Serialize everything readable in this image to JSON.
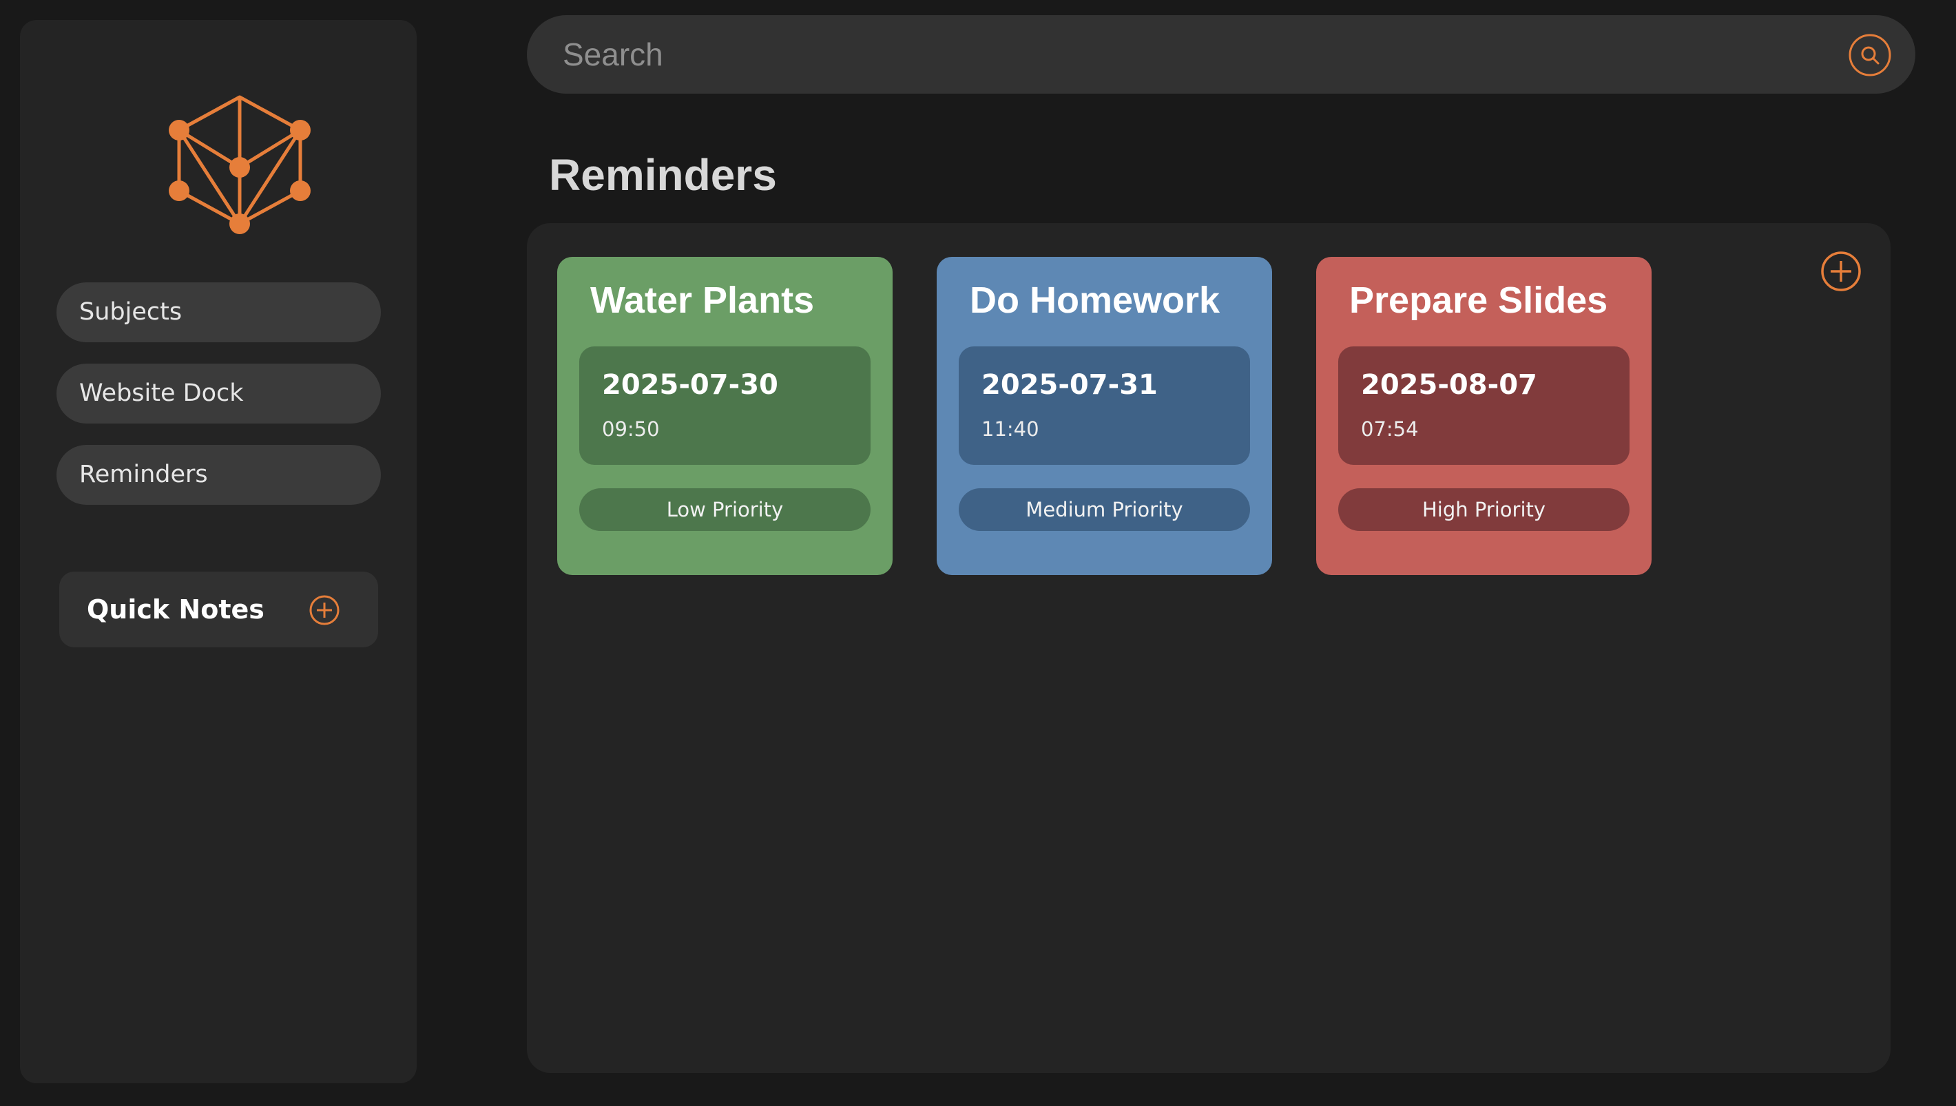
{
  "brand": {
    "accent": "#e67e3a",
    "logo": "hexagon-network-icon"
  },
  "sidebar": {
    "items": [
      {
        "label": "Subjects"
      },
      {
        "label": "Website Dock"
      },
      {
        "label": "Reminders"
      }
    ],
    "quick_notes": {
      "label": "Quick Notes",
      "add_icon": "plus-circle-icon"
    }
  },
  "search": {
    "placeholder": "Search",
    "value": "",
    "icon": "search-icon"
  },
  "main": {
    "title": "Reminders",
    "add_icon": "plus-circle-icon",
    "reminders": [
      {
        "title": "Water Plants",
        "date": "2025-07-30",
        "time": "09:50",
        "priority": "Low Priority",
        "color": "#6b9e66",
        "inner_color": "#4d774c"
      },
      {
        "title": "Do Homework",
        "date": "2025-07-31",
        "time": "11:40",
        "priority": "Medium Priority",
        "color": "#5e88b4",
        "inner_color": "#3f6287"
      },
      {
        "title": "Prepare Slides",
        "date": "2025-08-07",
        "time": "07:54",
        "priority": "High Priority",
        "color": "#c4605a",
        "inner_color": "#813b3c"
      }
    ]
  }
}
